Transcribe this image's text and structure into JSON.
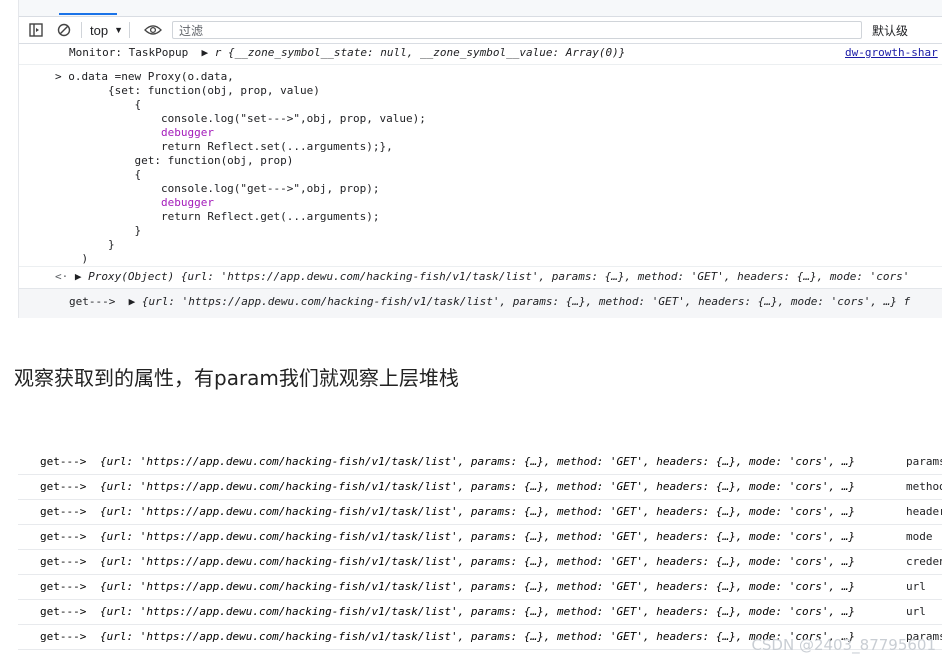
{
  "devtools": {
    "context": "top",
    "filter_placeholder": "过滤",
    "levels_label": "默认级",
    "monitor_line": "Monitor: TaskPopup",
    "monitor_obj": "r {__zone_symbol__state: null, __zone_symbol__value: Array(0)}",
    "monitor_link": "dw-growth-shar",
    "code_lines": [
      "> o.data =new Proxy(o.data,",
      "        {set: function(obj, prop, value)",
      "            {",
      "                console.log(\"set--->\",obj, prop, value);",
      "                debugger",
      "                return Reflect.set(...arguments);},",
      "            get: function(obj, prop)",
      "            {",
      "                console.log(\"get--->\",obj, prop);",
      "                debugger",
      "                return Reflect.get(...arguments);",
      "            }",
      "        }",
      "    )"
    ],
    "result_line": "Proxy(Object) {url: 'https://app.dewu.com/hacking-fish/v1/task/list', params: {…}, method: 'GET', headers: {…}, mode: 'cors'",
    "get_line_1": "{url: 'https://app.dewu.com/hacking-fish/v1/task/list', params: {…}, method: 'GET', headers: {…}, mode: 'cors', …} f"
  },
  "caption": "观察获取到的属性，有param我们就观察上层堆栈",
  "get_rows": [
    {
      "label": "get--->",
      "obj": "{url: 'https://app.dewu.com/hacking-fish/v1/task/list', params: {…}, method: 'GET', headers: {…}, mode: 'cors', …}",
      "tail": "params"
    },
    {
      "label": "get--->",
      "obj": "{url: 'https://app.dewu.com/hacking-fish/v1/task/list', params: {…}, method: 'GET', headers: {…}, mode: 'cors', …}",
      "tail": "method"
    },
    {
      "label": "get--->",
      "obj": "{url: 'https://app.dewu.com/hacking-fish/v1/task/list', params: {…}, method: 'GET', headers: {…}, mode: 'cors', …}",
      "tail": "headers"
    },
    {
      "label": "get--->",
      "obj": "{url: 'https://app.dewu.com/hacking-fish/v1/task/list', params: {…}, method: 'GET', headers: {…}, mode: 'cors', …}",
      "tail": "mode"
    },
    {
      "label": "get--->",
      "obj": "{url: 'https://app.dewu.com/hacking-fish/v1/task/list', params: {…}, method: 'GET', headers: {…}, mode: 'cors', …}",
      "tail": "credentials"
    },
    {
      "label": "get--->",
      "obj": "{url: 'https://app.dewu.com/hacking-fish/v1/task/list', params: {…}, method: 'GET', headers: {…}, mode: 'cors', …}",
      "tail": "url"
    },
    {
      "label": "get--->",
      "obj": "{url: 'https://app.dewu.com/hacking-fish/v1/task/list', params: {…}, method: 'GET', headers: {…}, mode: 'cors', …}",
      "tail": "url"
    },
    {
      "label": "get--->",
      "obj": "{url: 'https://app.dewu.com/hacking-fish/v1/task/list', params: {…}, method: 'GET', headers: {…}, mode: 'cors', …}",
      "tail": "params"
    }
  ],
  "watermark": "CSDN @2403_87795601"
}
